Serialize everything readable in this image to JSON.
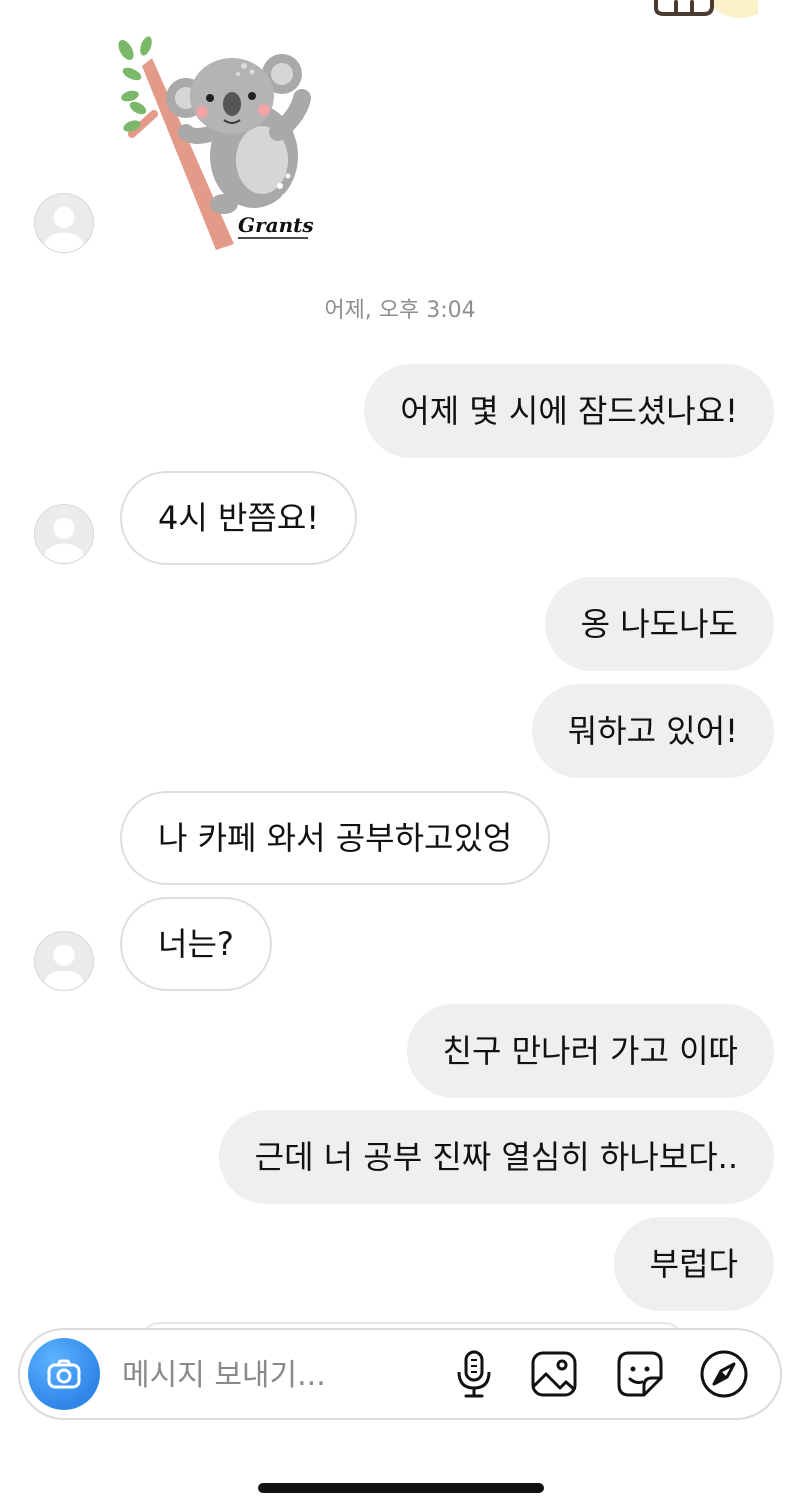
{
  "timestamp": "어제, 오후 3:04",
  "sticker": {
    "brand_text": "Grants"
  },
  "messages": [
    {
      "side": "out",
      "text": "어제 몇 시에 잠드셨나요!"
    },
    {
      "side": "in",
      "text": "4시 반쯤요!"
    },
    {
      "side": "out",
      "text": "옹 나도나도"
    },
    {
      "side": "out",
      "text": "뭐하고 있어!"
    },
    {
      "side": "in",
      "text": "나 카페 와서 공부하고있엉"
    },
    {
      "side": "in",
      "text": "너는?"
    },
    {
      "side": "out",
      "text": "친구 만나러 가고 이따"
    },
    {
      "side": "out",
      "text": "근데 너 공부 진짜 열심히 하나보다.."
    },
    {
      "side": "out",
      "text": "부럽다"
    }
  ],
  "composer": {
    "placeholder": "메시지 보내기...",
    "value": "",
    "icons": [
      "camera-icon",
      "microphone-icon",
      "gallery-icon",
      "sticker-icon",
      "explore-compass-icon"
    ]
  },
  "colors": {
    "outgoing_bubble": "#efefef",
    "incoming_border": "#dedede",
    "camera_button": "#3897f0",
    "timestamp_text": "#8e8e8e"
  }
}
